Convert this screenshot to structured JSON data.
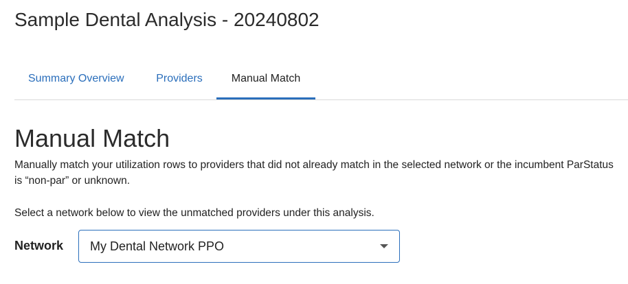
{
  "header": {
    "title": "Sample Dental Analysis - 20240802"
  },
  "tabs": [
    {
      "label": "Summary Overview",
      "active": false
    },
    {
      "label": "Providers",
      "active": false
    },
    {
      "label": "Manual Match",
      "active": true
    }
  ],
  "main": {
    "heading": "Manual Match",
    "description": "Manually match your utilization rows to providers that did not already match in the selected network or the incumbent ParStatus is “non-par” or unknown.",
    "instruction": "Select a network below to view the unmatched providers under this analysis.",
    "network_label": "Network",
    "network_selected": "My Dental Network PPO"
  },
  "colors": {
    "accent": "#2a6ebb",
    "text": "#222222",
    "divider": "#d9d9d9"
  },
  "icons": {
    "select_caret": "chevron-down-icon"
  }
}
